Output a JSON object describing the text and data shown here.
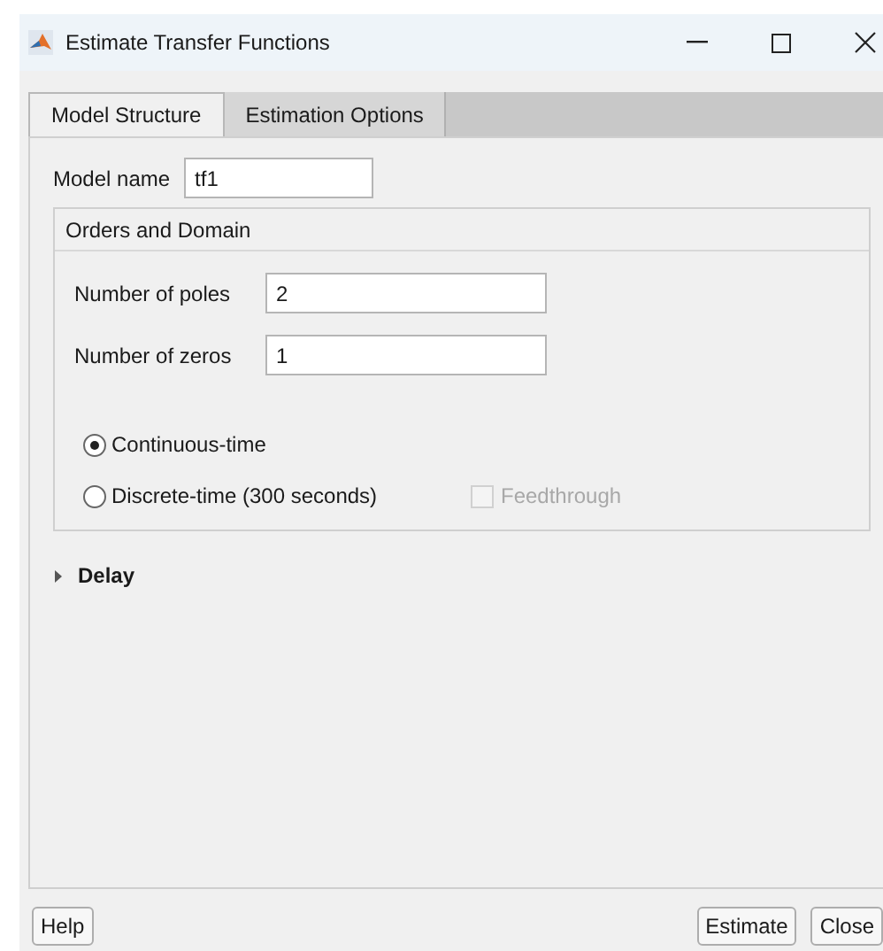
{
  "window": {
    "title": "Estimate Transfer Functions",
    "controls": [
      {
        "kind": "minimize"
      },
      {
        "kind": "maximize"
      },
      {
        "kind": "close"
      }
    ]
  },
  "tabs": [
    {
      "label": "Model Structure",
      "selected": true
    },
    {
      "label": "Estimation Options",
      "selected": false
    }
  ],
  "model_name": {
    "label": "Model name",
    "value": "tf1"
  },
  "orders_and_domain": {
    "title": "Orders and Domain",
    "fields": [
      {
        "label": "Number of poles",
        "value": "2"
      },
      {
        "label": "Number of zeros",
        "value": "1"
      }
    ],
    "domain": [
      {
        "label": "Continuous-time",
        "selected": true
      },
      {
        "label": "Discrete-time (300 seconds)",
        "selected": false
      }
    ],
    "feedthrough": {
      "label": "Feedthrough",
      "checked": false,
      "disabled": true
    }
  },
  "delay": {
    "label": "Delay",
    "expanded": false
  },
  "buttons": [
    {
      "label": "Help",
      "kind": "left"
    },
    {
      "label": "Estimate",
      "kind": "right"
    },
    {
      "label": "Close",
      "kind": "right"
    }
  ]
}
